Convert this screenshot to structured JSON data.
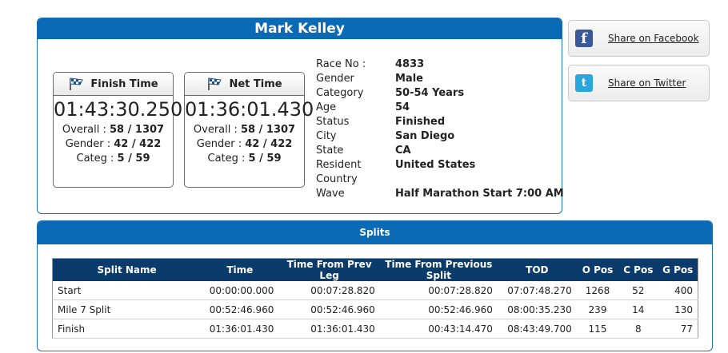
{
  "athlete": {
    "name": "Mark Kelley"
  },
  "finish_time": {
    "title": "Finish Time",
    "time": "01:43:30.250",
    "overall_label": "Overall :",
    "overall": "58 / 1307",
    "gender_label": "Gender :",
    "gender": "42 / 422",
    "categ_label": "Categ :",
    "categ": "5 / 59"
  },
  "net_time": {
    "title": "Net Time",
    "time": "01:36:01.430",
    "overall_label": "Overall :",
    "overall": "58 / 1307",
    "gender_label": "Gender :",
    "gender": "42 / 422",
    "categ_label": "Categ :",
    "categ": "5 / 59"
  },
  "info": [
    {
      "label": "Race No :",
      "value": "4833"
    },
    {
      "label": "Gender",
      "value": "Male"
    },
    {
      "label": "Category",
      "value": "50-54 Years"
    },
    {
      "label": "Age",
      "value": "54"
    },
    {
      "label": "Status",
      "value": "Finished"
    },
    {
      "label": "City",
      "value": "San Diego"
    },
    {
      "label": "State",
      "value": "CA"
    },
    {
      "label": "Resident Country",
      "value": "United States"
    },
    {
      "label": "Wave",
      "value": "Half Marathon Start 7:00 AM"
    }
  ],
  "share": {
    "facebook_label": "Share on Facebook",
    "twitter_label": "Share on Twitter"
  },
  "splits": {
    "title": "Splits",
    "columns": [
      "Split Name",
      "Time",
      "Time From Prev Leg",
      "Time From Previous Split",
      "TOD",
      "O Pos",
      "C Pos",
      "G Pos"
    ],
    "rows": [
      [
        "Start",
        "00:00:00.000",
        "00:07:28.820",
        "00:07:28.820",
        "07:07:48.270",
        "1268",
        "52",
        "400"
      ],
      [
        "Mile 7 Split",
        "00:52:46.960",
        "00:52:46.960",
        "00:52:46.960",
        "08:00:35.230",
        "239",
        "14",
        "130"
      ],
      [
        "Finish",
        "01:36:01.430",
        "01:36:01.430",
        "00:43:14.470",
        "08:43:49.700",
        "115",
        "8",
        "77"
      ]
    ]
  },
  "colors": {
    "header_blue": "#0a6ab5",
    "table_header": "#0b3b6a",
    "facebook": "#3b5998",
    "twitter": "#29a6dc"
  },
  "icons": [
    "checkered-flag-icon",
    "facebook-icon",
    "twitter-icon"
  ]
}
